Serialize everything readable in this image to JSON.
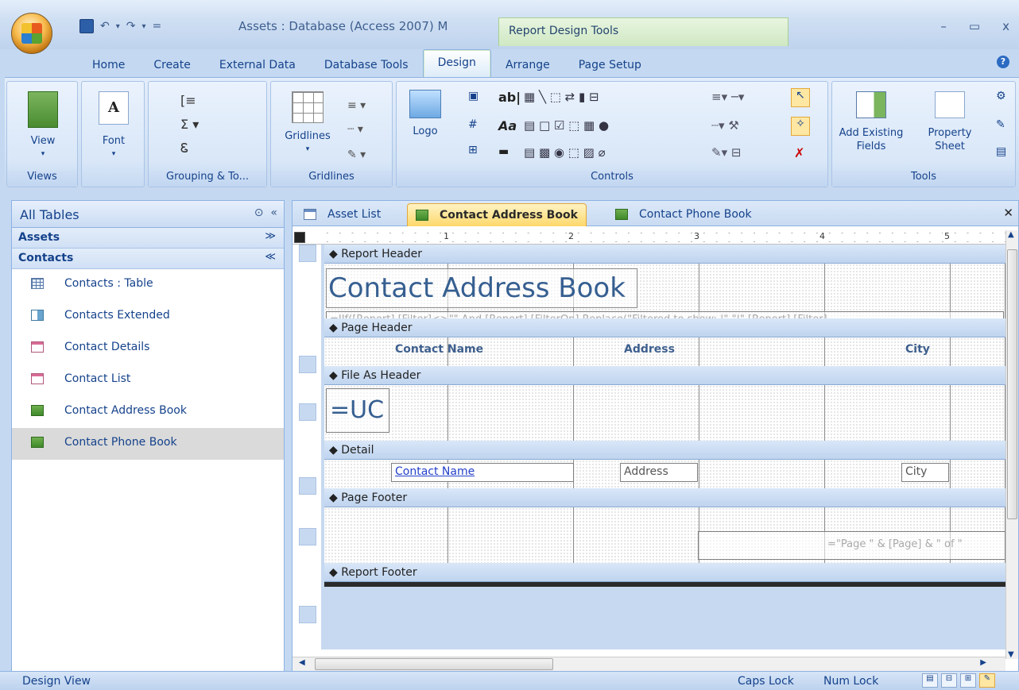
{
  "window": {
    "title": "Assets : Database (Access 2007) M",
    "contextual_tab_group": "Report Design Tools",
    "controls": {
      "minimize": "–",
      "maximize": "▭",
      "close": "x"
    }
  },
  "qat": {
    "save": "💾",
    "undo": "↶",
    "redo": "↷",
    "customize": "="
  },
  "ribbon": {
    "tabs": [
      "Home",
      "Create",
      "External Data",
      "Database Tools",
      "Design",
      "Arrange",
      "Page Setup"
    ],
    "active_tab": "Design",
    "groups": {
      "views": {
        "label": "Views",
        "view_button": "View"
      },
      "font": {
        "label": "",
        "font_button": "Font"
      },
      "grouping": {
        "label": "Grouping & To..."
      },
      "gridlines": {
        "label": "Gridlines",
        "gridlines_button": "Gridlines"
      },
      "controls": {
        "label": "Controls",
        "logo_button": "Logo",
        "textbox_glyph": "ab|",
        "label_glyph": "Aa"
      },
      "tools": {
        "label": "Tools",
        "add_existing_fields": "Add Existing Fields",
        "add_existing_line1": "Add Existing",
        "add_existing_line2": "Fields",
        "property_sheet_line1": "Property",
        "property_sheet_line2": "Sheet"
      }
    },
    "help": "?"
  },
  "navigation": {
    "header": "All Tables",
    "groups": [
      {
        "label": "Assets",
        "chevron": "≫",
        "expanded": false
      },
      {
        "label": "Contacts",
        "chevron": "≪",
        "expanded": true
      }
    ],
    "items": [
      {
        "label": "Contacts : Table",
        "icon": "table-icon"
      },
      {
        "label": "Contacts Extended",
        "icon": "query-icon"
      },
      {
        "label": "Contact Details",
        "icon": "form-icon"
      },
      {
        "label": "Contact List",
        "icon": "form-icon"
      },
      {
        "label": "Contact Address Book",
        "icon": "report-icon"
      },
      {
        "label": "Contact Phone Book",
        "icon": "report-icon",
        "selected": true
      }
    ]
  },
  "document_tabs": [
    {
      "label": "Asset List",
      "icon": "form-icon"
    },
    {
      "label": "Contact Address Book",
      "icon": "report-icon",
      "active": true
    },
    {
      "label": "Contact Phone Book",
      "icon": "report-icon"
    }
  ],
  "ruler": {
    "marks": [
      "1",
      "2",
      "3",
      "4",
      "5"
    ]
  },
  "report": {
    "sections": {
      "report_header": "Report Header",
      "page_header": "Page Header",
      "file_as_header": "File As Header",
      "detail": "Detail",
      "page_footer": "Page Footer",
      "report_footer": "Report Footer"
    },
    "title": "Contact Address Book",
    "filter_expr": "=IIf([Report].[Filter]<>\"\" And [Report].[FilterOn],Replace(\"Filtered to show: |\",\"|\",[Report].[Filter]",
    "page_header_labels": {
      "contact_name": "Contact Name",
      "address": "Address",
      "city": "City"
    },
    "group_expr": "=UC",
    "detail_fields": {
      "contact_name": "Contact Name",
      "address": "Address",
      "city": "City"
    },
    "page_expr": "=\"Page \" & [Page] & \" of \""
  },
  "status": {
    "mode": "Design View",
    "caps": "Caps Lock",
    "num": "Num Lock"
  },
  "colors": {
    "accent": "#15428b",
    "ribbon": "#dbe8f8",
    "active_tab": "#fdd86a"
  }
}
